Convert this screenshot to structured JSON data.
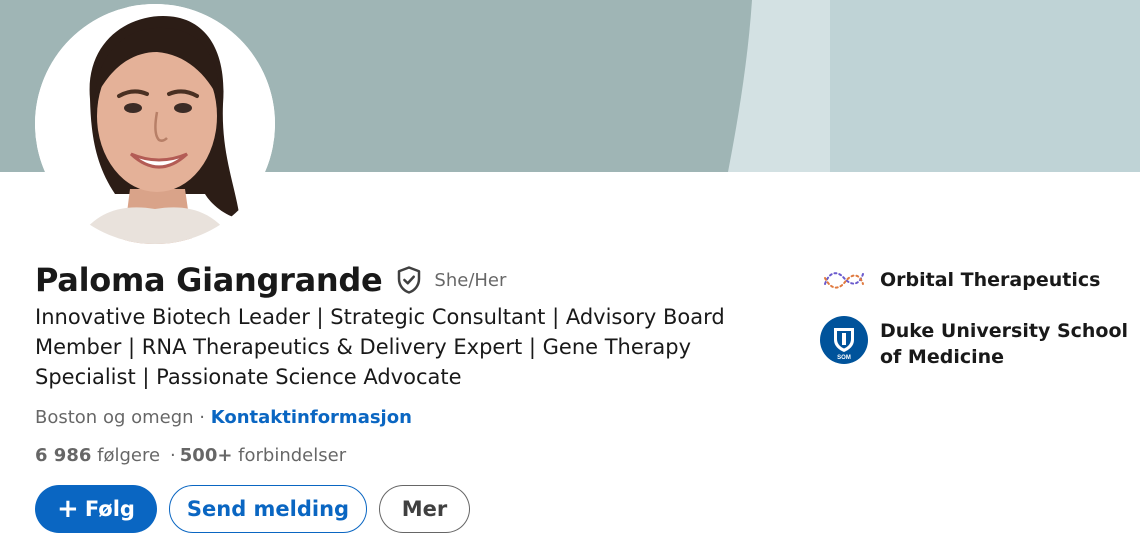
{
  "profile": {
    "name": "Paloma Giangrande",
    "pronouns": "She/Her",
    "headline": "Innovative Biotech Leader | Strategic Consultant | Advisory Board Member | RNA Therapeutics & Delivery Expert | Gene Therapy Specialist | Passionate Science Advocate",
    "location": "Boston og omegn",
    "location_separator": " · ",
    "contact_info_label": "Kontaktinformasjon",
    "followers": "6 986",
    "followers_label": "følgere",
    "connections_separator": "·",
    "connections": "500+",
    "connections_label": "forbindelser",
    "verified_icon": "shield-check-icon"
  },
  "actions": {
    "follow_icon": "+",
    "follow_label": "Følg",
    "message_label": "Send melding",
    "more_label": "Mer"
  },
  "organizations": [
    {
      "name": "Orbital Therapeutics",
      "logo": "orbital-logo"
    },
    {
      "name": "Duke University School of Medicine",
      "logo": "duke-som-logo",
      "logo_text": "SOM"
    }
  ],
  "colors": {
    "brand_blue": "#0a66c2",
    "banner_main": "#9fb5b5",
    "banner_light": "#d3e1e3",
    "banner_right": "#bfd3d6",
    "duke_blue": "#00539b"
  }
}
